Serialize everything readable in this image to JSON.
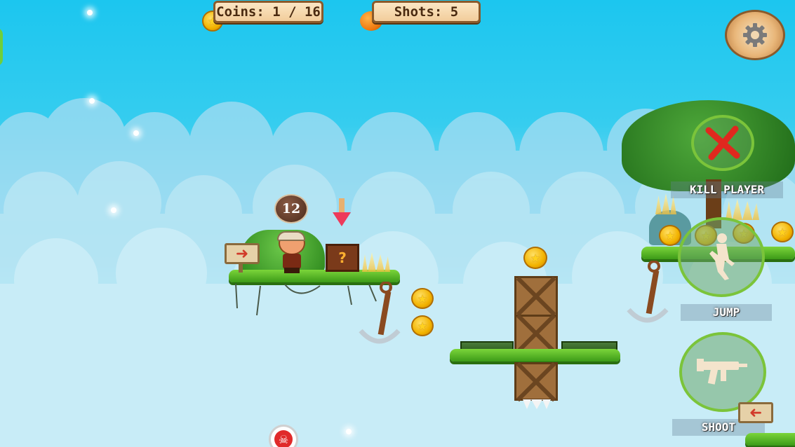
{
  "hud": {
    "coins_label": "Coins: 1 / 16",
    "shots_label": "Shots: 5",
    "settings_icon": "gear-icon"
  },
  "timer": {
    "value": "12"
  },
  "controls": {
    "kill_player_label": "KILL PLAYER",
    "jump_label": "JUMP",
    "shoot_label": "SHOOT"
  },
  "mystery_box": {
    "symbol": "?"
  },
  "colors": {
    "sky_top": "#1cc6ef",
    "sky_bottom": "#c4ebf6",
    "grass": "#5cbf2a",
    "coin": "#f2b300",
    "hud_border": "#8a5a2b",
    "control_ring": "#7bc43a",
    "kill_x": "#e0281e"
  },
  "icons": {
    "coin": "star-coin-icon",
    "shot": "orange-ball-icon",
    "kill": "red-x-icon",
    "jump": "running-figure-icon",
    "shoot": "gun-icon",
    "skull": "skull-icon",
    "arrow_sign": "red-arrow-sign-icon"
  }
}
